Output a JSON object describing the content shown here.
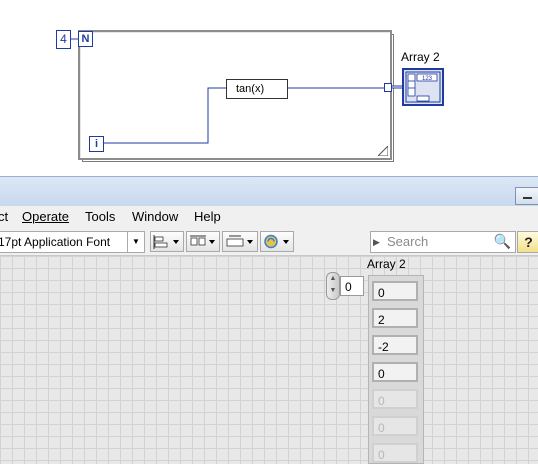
{
  "block_diagram": {
    "count_constant": "4",
    "count_terminal": "N",
    "iteration_terminal": "i",
    "function_node": "tan(x)",
    "array_indicator_label": "Array 2",
    "array_terminal_type": "123"
  },
  "menubar": {
    "items": [
      "ct",
      "Operate",
      "Tools",
      "Window",
      "Help"
    ]
  },
  "toolbar": {
    "font_selector": "17pt Application Font",
    "search_placeholder": "Search",
    "help_label": "?"
  },
  "front_panel": {
    "array_label": "Array 2",
    "index_value": "0",
    "values": [
      "0",
      "2",
      "-2",
      "0",
      "0",
      "0",
      "0"
    ]
  }
}
